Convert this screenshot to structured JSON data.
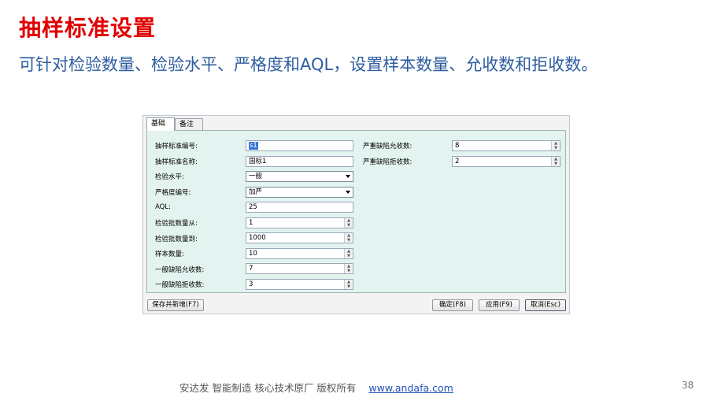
{
  "slide": {
    "title": "抽样标准设置",
    "subtitle": "可针对检验数量、检验水平、严格度和AQL，设置样本数量、允收数和拒收数。",
    "footer_text": "安达发   智能制造 核心技术原厂    版权所有",
    "footer_link": "www.andafa.com",
    "page_number": "38"
  },
  "dialog": {
    "tabs": [
      "基础",
      "备注"
    ],
    "active_tab": "基础",
    "fields_left": [
      {
        "label": "抽样标准编号:",
        "value": "s1",
        "kind": "text"
      },
      {
        "label": "抽样标准名称:",
        "value": "国标1",
        "kind": "text"
      },
      {
        "label": "检验水平:",
        "value": "一般",
        "kind": "select"
      },
      {
        "label": "严格度编号:",
        "value": "加严",
        "kind": "select"
      },
      {
        "label": "AQL:",
        "value": "25",
        "kind": "text"
      },
      {
        "label": "检验批数量从:",
        "value": "1",
        "kind": "number"
      },
      {
        "label": "检验批数量到:",
        "value": "1000",
        "kind": "number"
      },
      {
        "label": "样本数量:",
        "value": "10",
        "kind": "number"
      },
      {
        "label": "一般缺陷允收数:",
        "value": "7",
        "kind": "number"
      },
      {
        "label": "一般缺陷拒收数:",
        "value": "3",
        "kind": "number"
      }
    ],
    "fields_right": [
      {
        "label": "严重缺陷允收数:",
        "value": "8",
        "kind": "number"
      },
      {
        "label": "严重缺陷拒收数:",
        "value": "2",
        "kind": "number"
      }
    ],
    "buttons": {
      "save_new": "保存并新增(F7)",
      "ok": "确定(F8)",
      "apply": "应用(F9)",
      "cancel": "取消(Esc)"
    }
  },
  "colors": {
    "title": "#e10000",
    "subtitle": "#2e5d9f",
    "panel_bg": "#e3f3ef",
    "link": "#1f4fb5"
  }
}
